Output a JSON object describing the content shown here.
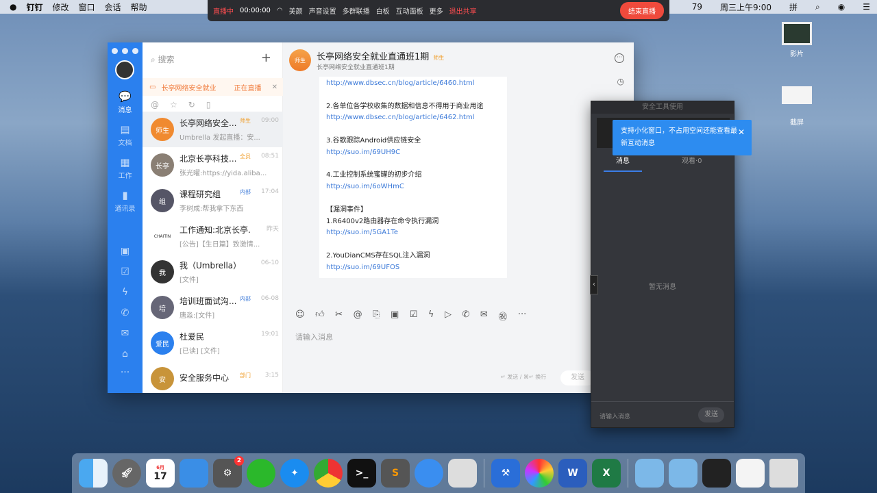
{
  "menubar": {
    "items": [
      "钉钉",
      "修改",
      "窗口",
      "会话",
      "帮助"
    ],
    "clock": "周三上午9:00",
    "input": "拼",
    "battery": "79"
  },
  "livebar": {
    "status": "直播中",
    "time": "00:00:00",
    "items": [
      "美颜",
      "声音设置",
      "多群联播",
      "白板",
      "互动面板",
      "更多"
    ],
    "exit": "退出共享",
    "end": "结束直播"
  },
  "sidebar": {
    "nav": [
      {
        "label": "消息",
        "icon": "💬"
      },
      {
        "label": "文档",
        "icon": "▤"
      },
      {
        "label": "工作",
        "icon": "▦"
      },
      {
        "label": "通讯录",
        "icon": "▮"
      }
    ],
    "more": "···"
  },
  "list": {
    "search_placeholder": "搜索",
    "live_banner": {
      "name": "长亭网络安全就业",
      "status": "正在直播"
    },
    "items": [
      {
        "name": "长亭网络安全...",
        "tag": "师生",
        "tag_color": "#f0a030",
        "time": "09:00",
        "preview": "Umbrella 发起直播：安...",
        "avatar": "师生",
        "color": "#f08a30"
      },
      {
        "name": "北京长亭科技...",
        "tag": "全员",
        "tag_color": "#f0a030",
        "time": "08:51",
        "preview": "张光曜:https://yida.aliba...",
        "avatar": "长亭",
        "color": "#8a7f74"
      },
      {
        "name": "课程研究组",
        "tag": "内部",
        "tag_color": "#3b79d8",
        "time": "17:04",
        "preview": "李树成:帮我拿下东西",
        "avatar": "组",
        "color": "#556"
      },
      {
        "name": "工作通知:北京长亭...",
        "tag": "",
        "tag_color": "",
        "time": "昨天",
        "preview": "[公告]【生日篇】致激情...",
        "avatar": "CHAITIN",
        "color": "#fff"
      },
      {
        "name": "我（Umbrella）",
        "tag": "",
        "tag_color": "",
        "time": "06-10",
        "preview": "[文件]",
        "avatar": "我",
        "color": "#333"
      },
      {
        "name": "培训班面试沟...",
        "tag": "内部",
        "tag_color": "#3b79d8",
        "time": "06-08",
        "preview": "唐淼:[文件]",
        "avatar": "培",
        "color": "#667"
      },
      {
        "name": "杜爱民",
        "tag": "",
        "tag_color": "",
        "time": "19:01",
        "preview": "[已读] [文件]",
        "avatar": "爱民",
        "color": "#2b80ee"
      },
      {
        "name": "安全服务中心",
        "tag": "部门",
        "tag_color": "#f0a030",
        "time": "3:15",
        "preview": "",
        "avatar": "安",
        "color": "#c8943a"
      }
    ]
  },
  "chat": {
    "title": "长亭网络安全就业直通班1期",
    "tag": "师生",
    "subtitle": "长亭网络安全就业直通班1期",
    "input_placeholder": "请输入消息",
    "hint": "↵ 发送 / ⌘↵ 换行",
    "send": "发送",
    "messages": [
      {
        "text": "",
        "link": "http://www.dbsec.cn/blog/article/6460.html"
      },
      {
        "text": "2.各单位各学校收集的数据和信息不得用于商业用途",
        "link": "http://www.dbsec.cn/blog/article/6462.html"
      },
      {
        "text": "3.谷歌跟踪Android供应链安全",
        "link": "http://suo.im/69UH9C"
      },
      {
        "text": "4.工业控制系统蜜罐的初步介绍",
        "link": "http://suo.im/6oWHmC"
      },
      {
        "text": "【漏洞事件】",
        "link": ""
      },
      {
        "text": "1.R6400v2路由器存在命令执行漏洞",
        "link": "http://suo.im/5GA1Te"
      },
      {
        "text": "2.YouDianCMS存在SQL注入漏洞",
        "link": "http://suo.im/69UFOS"
      }
    ]
  },
  "panel": {
    "title": "安全工具使用",
    "tabs": [
      "消息",
      "观看·0"
    ],
    "empty": "暂无消息",
    "input_placeholder": "请输入消息",
    "send": "发送"
  },
  "tooltip": {
    "text": "支持小化窗口，不占用空间还能查看最新互动消息"
  },
  "desktop": {
    "icons": [
      "影片",
      "截屏"
    ]
  },
  "dock": {
    "calendar_month": "6月",
    "calendar_day": "17",
    "settings_badge": "2"
  }
}
